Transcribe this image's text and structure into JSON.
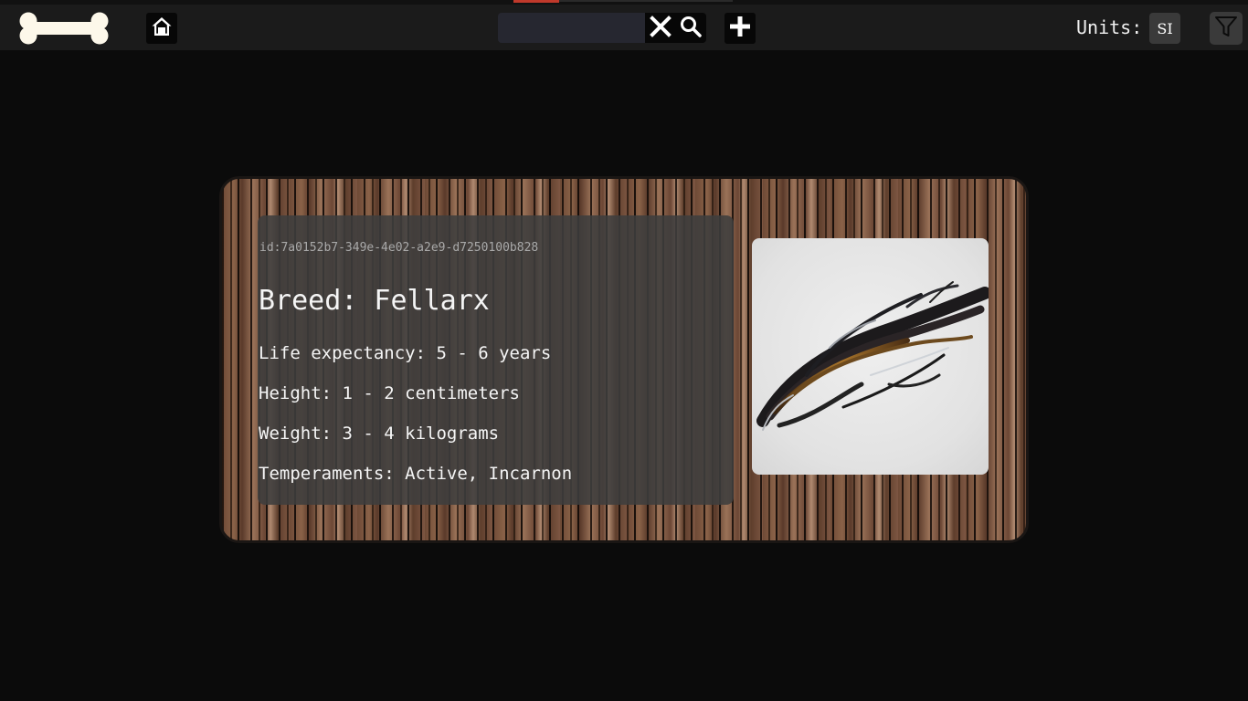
{
  "header": {
    "logo_icon": "bone-icon",
    "home_icon": "home-icon",
    "search": {
      "placeholder": "",
      "value": ""
    },
    "clear_icon": "close-icon",
    "search_icon": "search-icon",
    "add_icon": "plus-icon",
    "units_label": "Units:",
    "units_value": "SI",
    "filter_icon": "filter-icon"
  },
  "card": {
    "id": "id:7a0152b7-349e-4e02-a2e9-d7250100b828",
    "breed": "Breed: Fellarx",
    "life_expectancy": "Life expectancy: 5 - 6 years",
    "height": "Height: 1 - 2 centimeters",
    "weight": "Weight: 3 - 4 kilograms",
    "temperaments": "Temperaments: Active, Incarnon",
    "image_subject": "dark-metallic-weapon-sculpture"
  },
  "colors": {
    "background": "#0b0b0b",
    "navbar": "#1b1b1b",
    "accent": "#c0392b",
    "panel": "#3e3e3e",
    "wood_dark": "#5a3a2a",
    "wood_light": "#b08a70"
  }
}
